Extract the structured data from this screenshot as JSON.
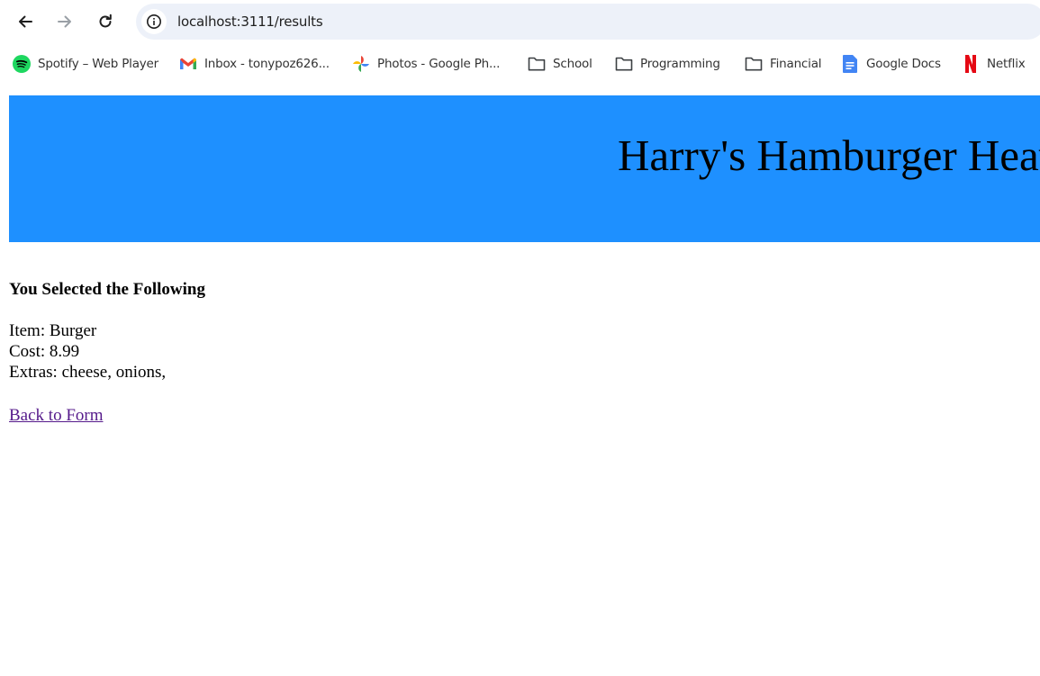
{
  "browser": {
    "url": "localhost:3111/results",
    "bookmarks": [
      {
        "label": "Spotify – Web Player",
        "icon": "spotify-icon"
      },
      {
        "label": "Inbox - tonypoz626...",
        "icon": "gmail-icon"
      },
      {
        "label": "Photos - Google Ph...",
        "icon": "google-photos-icon"
      },
      {
        "label": "School",
        "icon": "folder-icon"
      },
      {
        "label": "Programming",
        "icon": "folder-icon"
      },
      {
        "label": "Financial",
        "icon": "folder-icon"
      },
      {
        "label": "Google Docs",
        "icon": "google-docs-icon"
      },
      {
        "label": "Netflix",
        "icon": "netflix-icon"
      }
    ]
  },
  "page": {
    "banner_title": "Harry's Hamburger Heaven",
    "banner_color": "#1e90ff",
    "section_heading": "You Selected the Following",
    "item_line": "Item: Burger",
    "cost_line": "Cost: 8.99",
    "extras_line": "Extras: cheese, onions,",
    "back_link": "Back to Form",
    "link_color": "#551a8b"
  }
}
